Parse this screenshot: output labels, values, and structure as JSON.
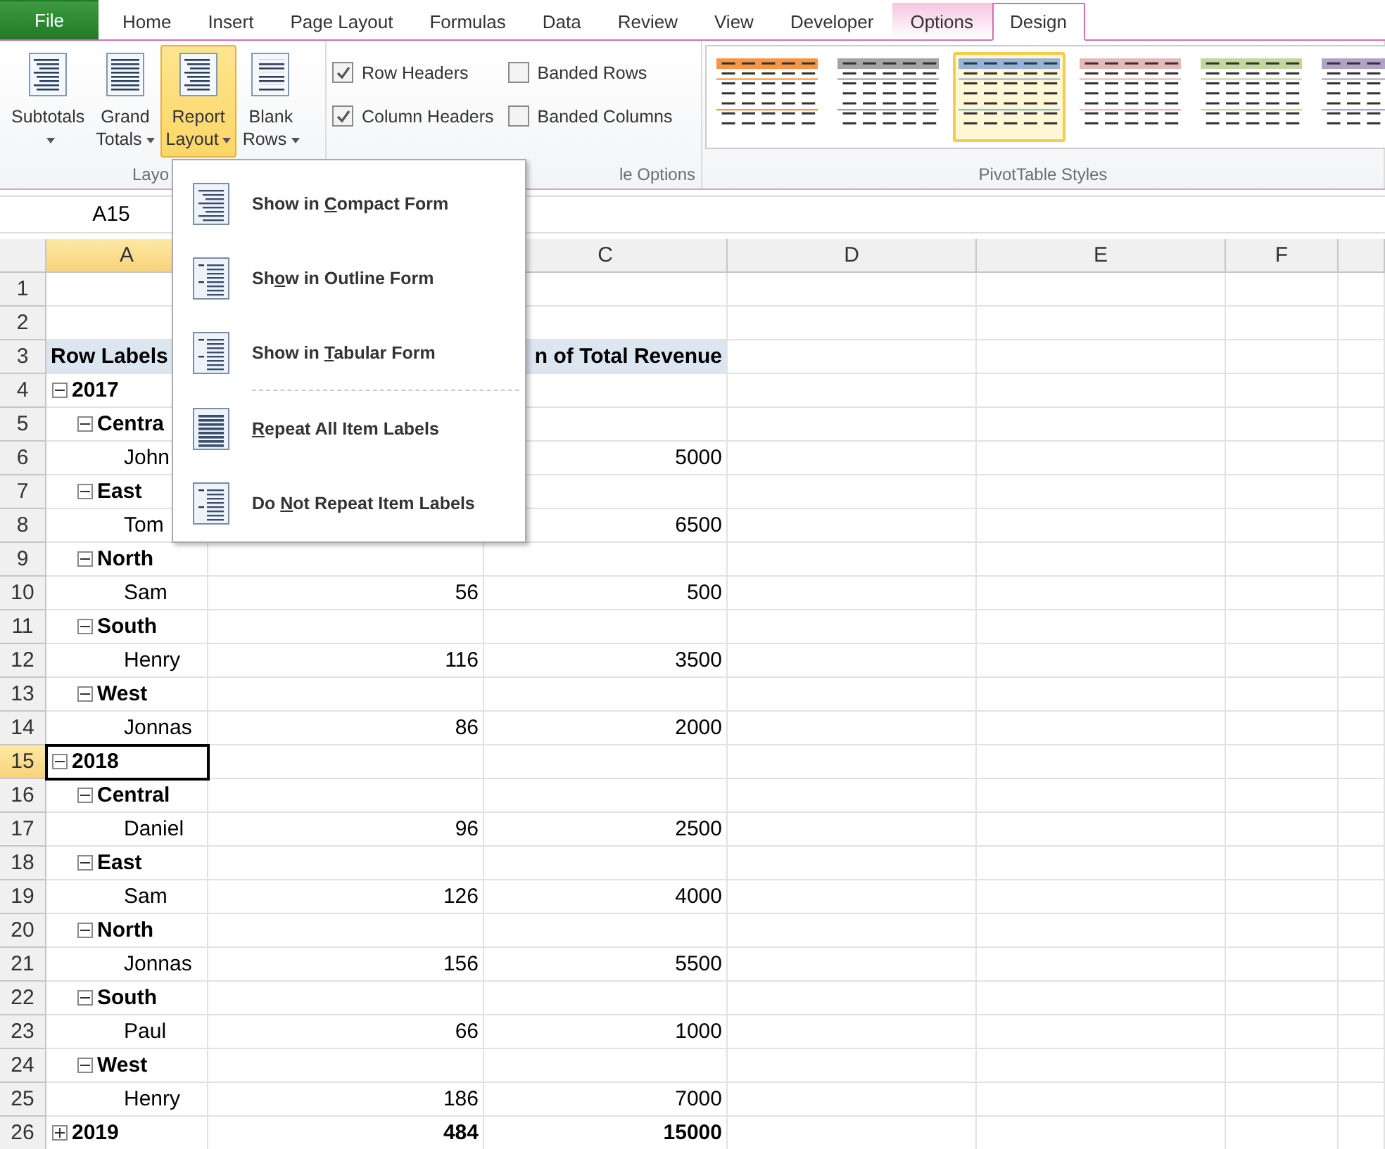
{
  "tabs": [
    {
      "label": "File",
      "kind": "file",
      "selected": false
    },
    {
      "label": "Home",
      "kind": "normal",
      "selected": false
    },
    {
      "label": "Insert",
      "kind": "normal",
      "selected": false
    },
    {
      "label": "Page Layout",
      "kind": "normal",
      "selected": false
    },
    {
      "label": "Formulas",
      "kind": "normal",
      "selected": false
    },
    {
      "label": "Data",
      "kind": "normal",
      "selected": false
    },
    {
      "label": "Review",
      "kind": "normal",
      "selected": false
    },
    {
      "label": "View",
      "kind": "normal",
      "selected": false
    },
    {
      "label": "Developer",
      "kind": "normal",
      "selected": false
    },
    {
      "label": "Options",
      "kind": "contextual",
      "selected": false
    },
    {
      "label": "Design",
      "kind": "contextual",
      "selected": true
    }
  ],
  "layout_group": {
    "label": "Layo",
    "buttons": [
      {
        "line1": "Subtotals",
        "pressed": false
      },
      {
        "line1": "Grand",
        "line2": "Totals",
        "pressed": false
      },
      {
        "line1": "Report",
        "line2": "Layout",
        "pressed": true
      },
      {
        "line1": "Blank",
        "line2": "Rows",
        "pressed": false
      }
    ]
  },
  "options_group": {
    "label": "le Options",
    "checkboxes": [
      {
        "label": "Row Headers",
        "checked": true
      },
      {
        "label": "Column Headers",
        "checked": true
      },
      {
        "label": "Banded Rows",
        "checked": false
      },
      {
        "label": "Banded Columns",
        "checked": false
      }
    ]
  },
  "styles_group": {
    "label": "PivotTable Styles",
    "styles": [
      {
        "color": "#f79646",
        "selected": false
      },
      {
        "color": "#a5a5a5",
        "selected": false
      },
      {
        "color": "#95b3d7",
        "selected": true
      },
      {
        "color": "#e6b9b8",
        "selected": false
      },
      {
        "color": "#c3d69b",
        "selected": false
      },
      {
        "color": "#b3a2c7",
        "selected": false
      }
    ]
  },
  "name_box": "A15",
  "columns": [
    {
      "label": "A",
      "selected": true
    },
    {
      "label": "C",
      "selected": false
    },
    {
      "label": "D",
      "selected": false
    },
    {
      "label": "E",
      "selected": false
    },
    {
      "label": "F",
      "selected": false
    }
  ],
  "rows": [
    {
      "number": "1",
      "kind": "empty",
      "selected": false
    },
    {
      "number": "2",
      "kind": "empty",
      "selected": false
    },
    {
      "number": "3",
      "kind": "header",
      "label": "Row Labels",
      "b": "",
      "c": "n of Total Revenue",
      "selected": false
    },
    {
      "number": "4",
      "kind": "year",
      "expanded": true,
      "label": "2017",
      "b": "",
      "c": "",
      "selected": false
    },
    {
      "number": "5",
      "kind": "region",
      "expanded": true,
      "label": "Centra",
      "b": "",
      "c": "",
      "selected": false
    },
    {
      "number": "6",
      "kind": "person",
      "label": "John",
      "b": "",
      "c": "5000",
      "selected": false
    },
    {
      "number": "7",
      "kind": "region",
      "expanded": true,
      "label": "East",
      "b": "",
      "c": "",
      "selected": false
    },
    {
      "number": "8",
      "kind": "person",
      "label": "Tom",
      "b": "",
      "c": "6500",
      "selected": false
    },
    {
      "number": "9",
      "kind": "region",
      "expanded": true,
      "label": "North",
      "b": "",
      "c": "",
      "selected": false
    },
    {
      "number": "10",
      "kind": "person",
      "label": "Sam",
      "b": "56",
      "c": "500",
      "selected": false
    },
    {
      "number": "11",
      "kind": "region",
      "expanded": true,
      "label": "South",
      "b": "",
      "c": "",
      "selected": false
    },
    {
      "number": "12",
      "kind": "person",
      "label": "Henry",
      "b": "116",
      "c": "3500",
      "selected": false
    },
    {
      "number": "13",
      "kind": "region",
      "expanded": true,
      "label": "West",
      "b": "",
      "c": "",
      "selected": false
    },
    {
      "number": "14",
      "kind": "person",
      "label": "Jonnas",
      "b": "86",
      "c": "2000",
      "selected": false
    },
    {
      "number": "15",
      "kind": "year",
      "expanded": true,
      "label": "2018",
      "b": "",
      "c": "",
      "selected": true
    },
    {
      "number": "16",
      "kind": "region",
      "expanded": true,
      "label": "Central",
      "b": "",
      "c": "",
      "selected": false
    },
    {
      "number": "17",
      "kind": "person",
      "label": "Daniel",
      "b": "96",
      "c": "2500",
      "selected": false
    },
    {
      "number": "18",
      "kind": "region",
      "expanded": true,
      "label": "East",
      "b": "",
      "c": "",
      "selected": false
    },
    {
      "number": "19",
      "kind": "person",
      "label": "Sam",
      "b": "126",
      "c": "4000",
      "selected": false
    },
    {
      "number": "20",
      "kind": "region",
      "expanded": true,
      "label": "North",
      "b": "",
      "c": "",
      "selected": false
    },
    {
      "number": "21",
      "kind": "person",
      "label": "Jonnas",
      "b": "156",
      "c": "5500",
      "selected": false
    },
    {
      "number": "22",
      "kind": "region",
      "expanded": true,
      "label": "South",
      "b": "",
      "c": "",
      "selected": false
    },
    {
      "number": "23",
      "kind": "person",
      "label": "Paul",
      "b": "66",
      "c": "1000",
      "selected": false
    },
    {
      "number": "24",
      "kind": "region",
      "expanded": true,
      "label": "West",
      "b": "",
      "c": "",
      "selected": false
    },
    {
      "number": "25",
      "kind": "person",
      "label": "Henry",
      "b": "186",
      "c": "7000",
      "selected": false
    },
    {
      "number": "26",
      "kind": "year",
      "expanded": false,
      "label": "2019",
      "b": "484",
      "c": "15000",
      "selected": false
    }
  ],
  "menu": {
    "items": [
      {
        "before": "Show in ",
        "key": "C",
        "after": "ompact Form",
        "kind": "compact"
      },
      {
        "before": "Sh",
        "key": "o",
        "after": "w in Outline Form",
        "kind": "outline"
      },
      {
        "before": "Show in ",
        "key": "T",
        "after": "abular Form",
        "kind": "tabular"
      },
      {
        "key": "R",
        "after": "epeat All Item Labels",
        "kind": "repeat"
      },
      {
        "before": "Do ",
        "key": "N",
        "after": "ot Repeat Item Labels",
        "kind": "norepeat"
      }
    ]
  }
}
